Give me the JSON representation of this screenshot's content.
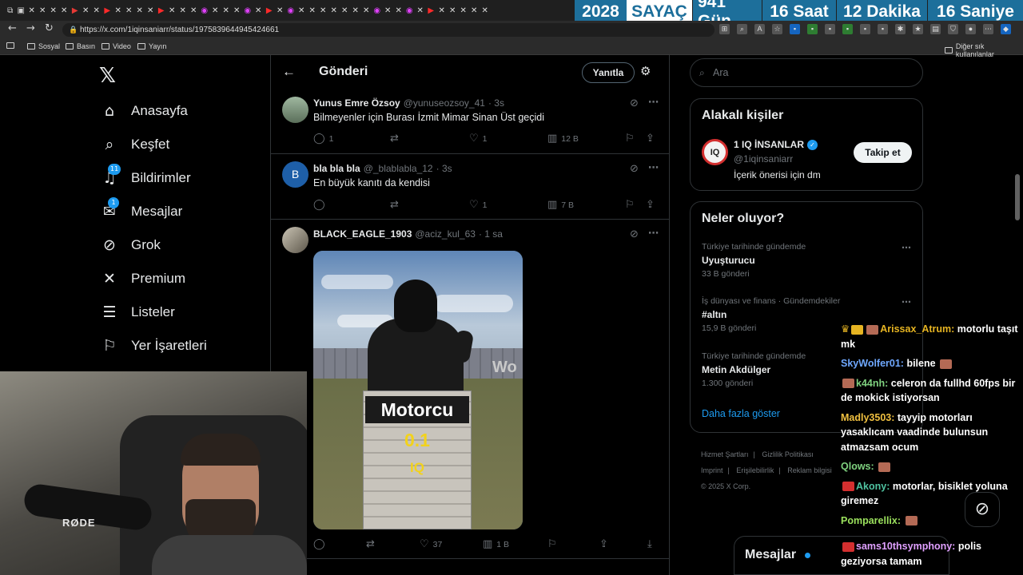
{
  "browser": {
    "url": "https://x.com/1iqinsaniarr/status/1975839644945424661",
    "bookmarks": [
      "Sosyal",
      "Basın",
      "Video",
      "Yayın"
    ],
    "bookmarks_other": "Diğer sık kullanılanlar"
  },
  "counter": {
    "year": "2028",
    "label": "SAYAÇ",
    "days": "941 Gün",
    "hours": "16 Saat",
    "minutes": "12 Dakika",
    "seconds": "16 Saniye"
  },
  "sidebar": {
    "items": [
      {
        "label": "Anasayfa",
        "icon": "home-icon"
      },
      {
        "label": "Keşfet",
        "icon": "search-icon"
      },
      {
        "label": "Bildirimler",
        "icon": "bell-icon",
        "badge": "11"
      },
      {
        "label": "Mesajlar",
        "icon": "mail-icon",
        "badge": "1"
      },
      {
        "label": "Grok",
        "icon": "grok-icon"
      },
      {
        "label": "Premium",
        "icon": "x-icon"
      },
      {
        "label": "Listeler",
        "icon": "list-icon"
      },
      {
        "label": "Yer İşaretleri",
        "icon": "bookmark-icon"
      }
    ]
  },
  "header": {
    "title": "Gönderi",
    "reply_label": "Yanıtla"
  },
  "tweets": [
    {
      "name": "Yunus Emre Özsoy",
      "handle": "@yunuseozsoy_41",
      "time": "· 3s",
      "text": "Bilmeyenler için Burası İzmit Mimar Sinan Üst geçidi",
      "replies": "1",
      "likes": "1",
      "views": "12 B"
    },
    {
      "name": "bla bla bla",
      "handle": "@_blablabla_12",
      "time": "· 3s",
      "text": "En büyük kanıtı da kendisi",
      "avatar_letter": "B",
      "replies": "",
      "likes": "1",
      "views": "7 B"
    },
    {
      "name": "BLACK_EAGLE_1903",
      "handle": "@aciz_kul_63",
      "time": "· 1 sa",
      "text": "",
      "replies": "",
      "likes": "37",
      "views": "1 B",
      "media": {
        "sign_title": "Motorcu",
        "sign_value": "0.1",
        "sign_unit": "IQ",
        "wall_text": "Wo"
      }
    }
  ],
  "right": {
    "search_placeholder": "Ara",
    "related_title": "Alakalı kişiler",
    "person": {
      "name": "1 IQ İNSANLAR",
      "handle": "@1iqinsaniarr",
      "bio": "İçerik önerisi için dm",
      "follow_label": "Takip et"
    },
    "trends_title": "Neler oluyor?",
    "trends": [
      {
        "context": "Türkiye tarihinde gündemde",
        "name": "Uyuşturucu",
        "count": "33 B gönderi"
      },
      {
        "context": "İş dünyası ve finans · Gündemdekiler",
        "name": "#altın",
        "count": "15,9 B gönderi"
      },
      {
        "context": "Türkiye tarihinde gündemde",
        "name": "Metin Akdülger",
        "count": "1.300 gönderi"
      }
    ],
    "show_more": "Daha fazla göster",
    "footer": [
      "Hizmet Şartları",
      "Gizlilik Politikası",
      "Imprint",
      "Erişilebilirlik",
      "Reklam bilgisi",
      "© 2025 X Corp."
    ]
  },
  "chat": [
    {
      "user": "Arissax_Atrum:",
      "color": "#e6b422",
      "msg": "motorlu taşıt mk"
    },
    {
      "user": "SkyWolfer01:",
      "color": "#6fa8ff",
      "msg": "bilene"
    },
    {
      "user": "k44nh:",
      "color": "#7fd17f",
      "msg": "celeron da fullhd 60fps bir de mokick istiyorsan"
    },
    {
      "user": "Madly3503:",
      "color": "#f0c040",
      "msg": "tayyip motorları yasaklıcam vaadinde bulunsun atmazsam ocum"
    },
    {
      "user": "Qlows:",
      "color": "#7fd17f",
      "msg": ""
    },
    {
      "user": "Akony:",
      "color": "#4fc3a1",
      "msg": "motorlar, bisiklet yoluna giremez"
    },
    {
      "user": "Pomparellix:",
      "color": "#9be15d",
      "msg": ""
    },
    {
      "user": "sams10thsymphony:",
      "color": "#e0a0ff",
      "msg": "polis geziyorsa tamam"
    }
  ],
  "messages_bar": "Mesajlar",
  "overlay_brand": "RØDE"
}
